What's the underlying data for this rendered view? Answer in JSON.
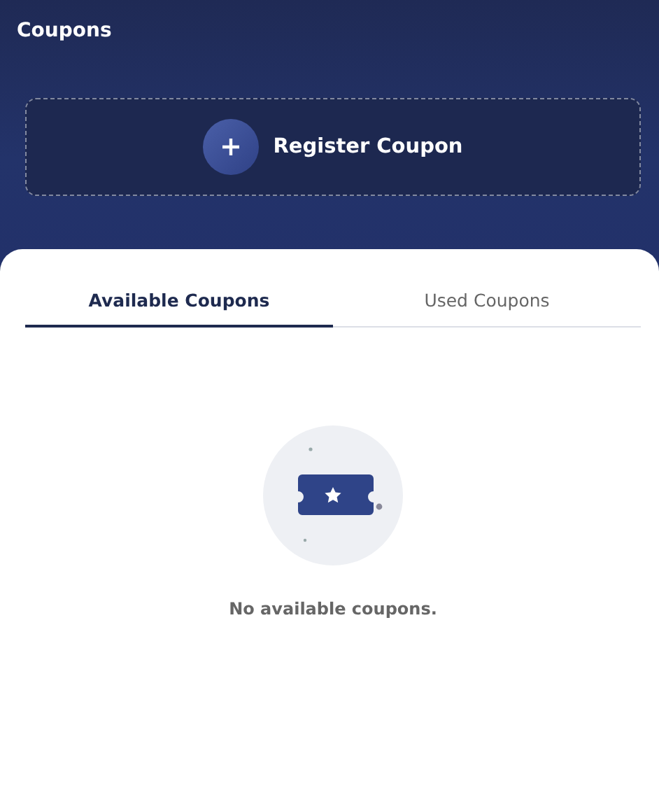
{
  "header": {
    "title": "Coupons",
    "register_button": "Register Coupon"
  },
  "tabs": [
    {
      "label": "Available Coupons",
      "selected": true
    },
    {
      "label": "Used Coupons",
      "selected": false
    }
  ],
  "empty_state": {
    "message": "No available coupons."
  }
}
